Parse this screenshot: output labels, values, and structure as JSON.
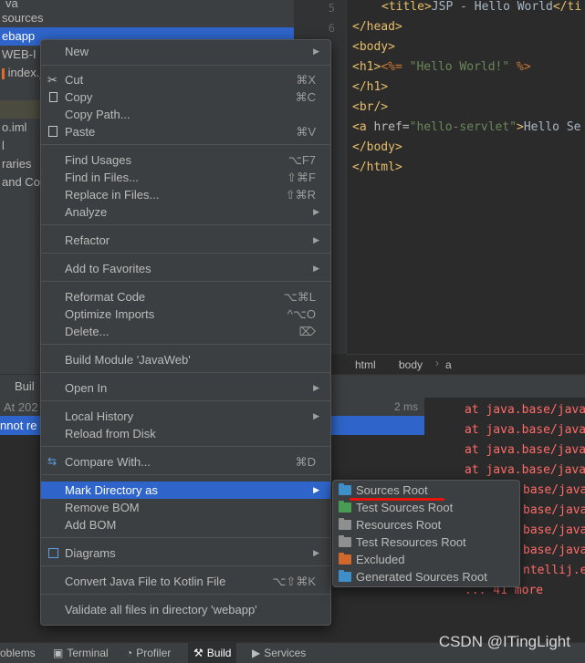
{
  "tree": {
    "rows": [
      "va",
      "sources",
      "ebapp",
      "WEB-I",
      "index.j",
      "",
      "o.iml",
      "l",
      "raries",
      "and Con"
    ]
  },
  "editor": {
    "line_numbers": [
      "5",
      "6"
    ],
    "lines": [
      {
        "parts": [
          [
            "tag",
            "<title>"
          ],
          [
            "txt",
            "JSP - Hello World"
          ],
          [
            "tag",
            "</ti"
          ]
        ]
      },
      {
        "parts": [
          [
            "tag",
            "</head>"
          ]
        ]
      },
      {
        "parts": [
          [
            "tag",
            "<body>"
          ]
        ]
      },
      {
        "parts": [
          [
            "tag",
            "<h1>"
          ],
          [
            "jsp",
            "<%= "
          ],
          [
            "str",
            "\"Hello World!\""
          ],
          [
            "jsp",
            " %>"
          ]
        ]
      },
      {
        "parts": [
          [
            "tag",
            "</h1>"
          ]
        ]
      },
      {
        "parts": [
          [
            "tag",
            "<br/>"
          ]
        ]
      },
      {
        "parts": [
          [
            "tag",
            "<a "
          ],
          [
            "attr",
            "href="
          ],
          [
            "str",
            "\"hello-servlet\""
          ],
          [
            "tag",
            ">"
          ],
          [
            "txt",
            "Hello Se"
          ]
        ]
      },
      {
        "parts": [
          [
            "tag",
            "</body>"
          ]
        ]
      },
      {
        "parts": [
          [
            "tag",
            "</html>"
          ]
        ]
      }
    ],
    "breadcrumb": [
      "html",
      "body",
      "a"
    ]
  },
  "build": {
    "tab_label": "Buil",
    "row1": "At 202",
    "row1_time": "2 ms",
    "row2": "nnot re",
    "console": [
      "at java.base/java",
      "at java.base/java",
      "at java.base/java",
      "at java.base/java",
      "base/java",
      "base/java",
      "base/java",
      "base/java",
      "ntellij.e",
      "... 41 more"
    ]
  },
  "bottom_tabs": [
    {
      "label": "oblems",
      "icon": ""
    },
    {
      "label": "Terminal",
      "icon": "terminal-icon"
    },
    {
      "label": "Profiler",
      "icon": "profiler-icon"
    },
    {
      "label": "Build",
      "icon": "hammer-icon"
    },
    {
      "label": "Services",
      "icon": "services-icon"
    }
  ],
  "watermark": "CSDN @ITingLight",
  "menu": {
    "new": "New",
    "cut": "Cut",
    "cut_sc": "⌘X",
    "copy": "Copy",
    "copy_sc": "⌘C",
    "copy_path": "Copy Path...",
    "paste": "Paste",
    "paste_sc": "⌘V",
    "find_usages": "Find Usages",
    "find_usages_sc": "⌥F7",
    "find_in_files": "Find in Files...",
    "find_in_files_sc": "⇧⌘F",
    "replace_in_files": "Replace in Files...",
    "replace_in_files_sc": "⇧⌘R",
    "analyze": "Analyze",
    "refactor": "Refactor",
    "add_to_favorites": "Add to Favorites",
    "reformat_code": "Reformat Code",
    "reformat_code_sc": "⌥⌘L",
    "optimize_imports": "Optimize Imports",
    "optimize_imports_sc": "^⌥O",
    "delete": "Delete...",
    "delete_sc": "⌦",
    "build_module": "Build Module 'JavaWeb'",
    "open_in": "Open In",
    "local_history": "Local History",
    "reload_from_disk": "Reload from Disk",
    "compare_with": "Compare With...",
    "compare_with_sc": "⌘D",
    "mark_directory_as": "Mark Directory as",
    "remove_bom": "Remove BOM",
    "add_bom": "Add BOM",
    "diagrams": "Diagrams",
    "convert_kotlin": "Convert Java File to Kotlin File",
    "convert_kotlin_sc": "⌥⇧⌘K",
    "validate": "Validate all files in directory 'webapp'"
  },
  "submenu": {
    "items": [
      {
        "label": "Sources Root",
        "color": "#3d8ec9"
      },
      {
        "label": "Test Sources Root",
        "color": "#499c54"
      },
      {
        "label": "Resources Root",
        "color": "#8f8f8f"
      },
      {
        "label": "Test Resources Root",
        "color": "#8f8f8f"
      },
      {
        "label": "Excluded",
        "color": "#d0682b"
      },
      {
        "label": "Generated Sources Root",
        "color": "#3d8ec9"
      }
    ]
  }
}
